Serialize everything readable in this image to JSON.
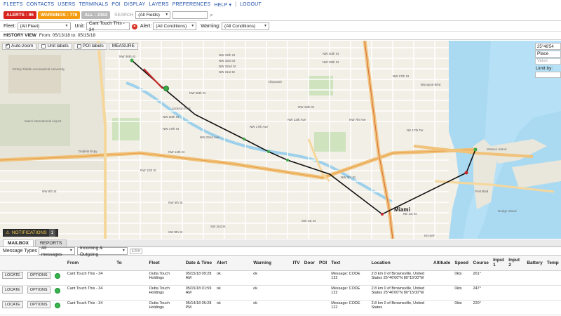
{
  "topnav": [
    "FLEETS",
    "CONTACTS",
    "USERS",
    "TERMINALS",
    "POI",
    "DISPLAY",
    "LAYERS",
    "PREFERENCES",
    "HELP"
  ],
  "topnav_logout": "LOGOUT",
  "tabs": {
    "alerts": "ALERTS : 96",
    "warnings": "WARNINGS : 776",
    "all": "ALL : 2153",
    "search_label": "SEARCH",
    "search_field": "(All Fields)"
  },
  "filters": {
    "fleet_label": "Fleet:",
    "fleet_value": "(All Fleet)",
    "unit_label": "Unit:",
    "unit_value": "Cant Touch This - 34",
    "alert_label": "Alert:",
    "alert_value": "(All Conditions)",
    "warning_label": "Warning:",
    "warning_value": "(All Conditions)"
  },
  "history": {
    "label": "HISTORY VIEW",
    "range": "From: 05/13/18  to: 05/15/18"
  },
  "map": {
    "autozoom": "Auto-zoom",
    "unit_labels": "Unit labels",
    "poi_labels": "POI labels",
    "measure": "MEASURE",
    "coord": "25°46'54",
    "place_label": "Place",
    "value_placeholder": "Value",
    "limit_by": "Limit by:",
    "notifications": "NOTIFICATIONS",
    "notifications_count": "1",
    "city_label": "Miami",
    "labels": {
      "l1": "NW 34th St",
      "l2": "NW 33rd St",
      "l3": "NW 32nd St",
      "l4": "NW 31st St",
      "l5": "NW 30th St",
      "l6": "NW 29th St",
      "l7": "NW 28th St",
      "l8": "NW 27th St",
      "l9": "NW 20th St",
      "l10": "NW 18th St",
      "l11": "NW 17th St",
      "l12": "NW 14th St",
      "l13": "NW 11th St",
      "l14": "NW 8th St",
      "l15": "NW 5th St",
      "l16": "NW 3rd St",
      "l17": "SW 1st St",
      "l18": "SW 2nd St",
      "l19": "SW 8th St",
      "l20": "NE 1st St",
      "l21": "Dolphin Expy",
      "l22": "Watson Island",
      "l23": "Dodge Island",
      "l24": "Port Blvd",
      "l25": "Brickell",
      "l26": "Allapattah",
      "l27": "Jackson Park",
      "l28": "NE 17th Ter",
      "l29": "NW 36th St",
      "l30": "NW 22nd Ave",
      "l31": "NW 17th Ave",
      "l32": "NW 12th Ave",
      "l33": "NW 7th Ave",
      "l34": "Biscayne Blvd",
      "l35": "Miami International Airport",
      "l36": "Embry-Riddle Aeronautical University"
    }
  },
  "bottom": {
    "tab_mailbox": "MAILBOX",
    "tab_reports": "REPORTS",
    "msg_label": "Message Types",
    "msg_value": "All messages",
    "direction_value": "Incoming & Outgoing",
    "csv": "CSV",
    "columns": [
      "",
      "",
      "",
      "From",
      "To",
      "Fleet",
      "Date & Time",
      "Alert",
      "Warning",
      "ITV",
      "Door",
      "POI",
      "Text",
      "Location",
      "Altitude",
      "Speed",
      "Course",
      "Input 1",
      "Input 2",
      "Battery",
      "Temp"
    ],
    "rows": [
      {
        "from": "Cant Touch This - 34",
        "fleet": "Outta Touch Holdings",
        "datetime": "05/15/18 09:28 AM",
        "alert": "ok",
        "warning": "ok",
        "text": "Message:   CODE 122",
        "location": "2.8 km 0 of Brownsville, United States 25°46'00\"N 80°15'00\"W",
        "speed": "0kts",
        "course": "261°"
      },
      {
        "from": "Cant Touch This - 34",
        "fleet": "Outta Touch Holdings",
        "datetime": "05/15/18 01:59 AM",
        "alert": "ok",
        "warning": "ok",
        "text": "Message:   CODE 122",
        "location": "2.8 km 0 of Brownsville, United States 25°46'00\"N 80°15'00\"W",
        "speed": "0kts",
        "course": "247°"
      },
      {
        "from": "Cant Touch This - 34",
        "fleet": "Outta Touch Holdings",
        "datetime": "05/14/18 05:28 PM",
        "alert": "ok",
        "warning": "ok",
        "text": "Message:   CODE 122",
        "location": "2.8 km 0 of Brownsville, United States",
        "speed": "0kts",
        "course": "220°"
      }
    ],
    "locate": "LOCATE",
    "options": "OPTIONS"
  }
}
